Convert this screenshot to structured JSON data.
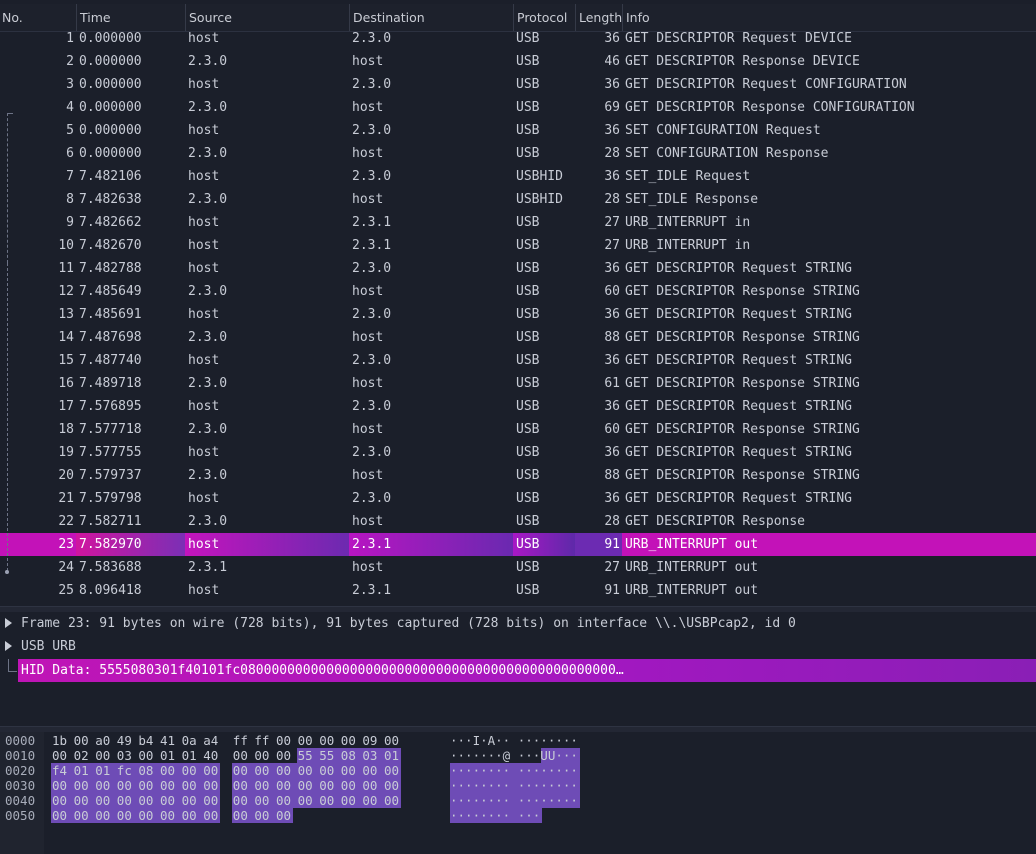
{
  "columns": {
    "no": "No.",
    "time": "Time",
    "source": "Source",
    "destination": "Destination",
    "protocol": "Protocol",
    "length": "Length",
    "info": "Info"
  },
  "packets": [
    {
      "no": "1",
      "time": "0.000000",
      "src": "host",
      "dst": "2.3.0",
      "proto": "USB",
      "len": "36",
      "info": "GET DESCRIPTOR Request DEVICE"
    },
    {
      "no": "2",
      "time": "0.000000",
      "src": "2.3.0",
      "dst": "host",
      "proto": "USB",
      "len": "46",
      "info": "GET DESCRIPTOR Response DEVICE"
    },
    {
      "no": "3",
      "time": "0.000000",
      "src": "host",
      "dst": "2.3.0",
      "proto": "USB",
      "len": "36",
      "info": "GET DESCRIPTOR Request CONFIGURATION"
    },
    {
      "no": "4",
      "time": "0.000000",
      "src": "2.3.0",
      "dst": "host",
      "proto": "USB",
      "len": "69",
      "info": "GET DESCRIPTOR Response CONFIGURATION"
    },
    {
      "no": "5",
      "time": "0.000000",
      "src": "host",
      "dst": "2.3.0",
      "proto": "USB",
      "len": "36",
      "info": "SET CONFIGURATION Request"
    },
    {
      "no": "6",
      "time": "0.000000",
      "src": "2.3.0",
      "dst": "host",
      "proto": "USB",
      "len": "28",
      "info": "SET CONFIGURATION Response"
    },
    {
      "no": "7",
      "time": "7.482106",
      "src": "host",
      "dst": "2.3.0",
      "proto": "USBHID",
      "len": "36",
      "info": "SET_IDLE Request"
    },
    {
      "no": "8",
      "time": "7.482638",
      "src": "2.3.0",
      "dst": "host",
      "proto": "USBHID",
      "len": "28",
      "info": "SET_IDLE Response"
    },
    {
      "no": "9",
      "time": "7.482662",
      "src": "host",
      "dst": "2.3.1",
      "proto": "USB",
      "len": "27",
      "info": "URB_INTERRUPT in"
    },
    {
      "no": "10",
      "time": "7.482670",
      "src": "host",
      "dst": "2.3.1",
      "proto": "USB",
      "len": "27",
      "info": "URB_INTERRUPT in"
    },
    {
      "no": "11",
      "time": "7.482788",
      "src": "host",
      "dst": "2.3.0",
      "proto": "USB",
      "len": "36",
      "info": "GET DESCRIPTOR Request STRING"
    },
    {
      "no": "12",
      "time": "7.485649",
      "src": "2.3.0",
      "dst": "host",
      "proto": "USB",
      "len": "60",
      "info": "GET DESCRIPTOR Response STRING"
    },
    {
      "no": "13",
      "time": "7.485691",
      "src": "host",
      "dst": "2.3.0",
      "proto": "USB",
      "len": "36",
      "info": "GET DESCRIPTOR Request STRING"
    },
    {
      "no": "14",
      "time": "7.487698",
      "src": "2.3.0",
      "dst": "host",
      "proto": "USB",
      "len": "88",
      "info": "GET DESCRIPTOR Response STRING"
    },
    {
      "no": "15",
      "time": "7.487740",
      "src": "host",
      "dst": "2.3.0",
      "proto": "USB",
      "len": "36",
      "info": "GET DESCRIPTOR Request STRING"
    },
    {
      "no": "16",
      "time": "7.489718",
      "src": "2.3.0",
      "dst": "host",
      "proto": "USB",
      "len": "61",
      "info": "GET DESCRIPTOR Response STRING"
    },
    {
      "no": "17",
      "time": "7.576895",
      "src": "host",
      "dst": "2.3.0",
      "proto": "USB",
      "len": "36",
      "info": "GET DESCRIPTOR Request STRING"
    },
    {
      "no": "18",
      "time": "7.577718",
      "src": "2.3.0",
      "dst": "host",
      "proto": "USB",
      "len": "60",
      "info": "GET DESCRIPTOR Response STRING"
    },
    {
      "no": "19",
      "time": "7.577755",
      "src": "host",
      "dst": "2.3.0",
      "proto": "USB",
      "len": "36",
      "info": "GET DESCRIPTOR Request STRING"
    },
    {
      "no": "20",
      "time": "7.579737",
      "src": "2.3.0",
      "dst": "host",
      "proto": "USB",
      "len": "88",
      "info": "GET DESCRIPTOR Response STRING"
    },
    {
      "no": "21",
      "time": "7.579798",
      "src": "host",
      "dst": "2.3.0",
      "proto": "USB",
      "len": "36",
      "info": "GET DESCRIPTOR Request STRING"
    },
    {
      "no": "22",
      "time": "7.582711",
      "src": "2.3.0",
      "dst": "host",
      "proto": "USB",
      "len": "28",
      "info": "GET DESCRIPTOR Response"
    },
    {
      "no": "23",
      "time": "7.582970",
      "src": "host",
      "dst": "2.3.1",
      "proto": "USB",
      "len": "91",
      "info": "URB_INTERRUPT out",
      "selected": true
    },
    {
      "no": "24",
      "time": "7.583688",
      "src": "2.3.1",
      "dst": "host",
      "proto": "USB",
      "len": "27",
      "info": "URB_INTERRUPT out"
    },
    {
      "no": "25",
      "time": "8.096418",
      "src": "host",
      "dst": "2.3.1",
      "proto": "USB",
      "len": "91",
      "info": "URB_INTERRUPT out"
    }
  ],
  "details": {
    "frame": "Frame 23: 91 bytes on wire (728 bits), 91 bytes captured (728 bits) on interface \\\\.\\USBPcap2, id 0",
    "usb_urb": "USB URB",
    "hid_data": "HID Data: 5555080301f40101fc080000000000000000000000000000000000000000000000…"
  },
  "hex": [
    {
      "off": "0000",
      "bytes": [
        "1b",
        "00",
        "a0",
        "49",
        "b4",
        "41",
        "0a",
        "a4",
        "ff",
        "ff",
        "00",
        "00",
        "00",
        "00",
        "09",
        "00"
      ],
      "ascii": "···I·A·· ········"
    },
    {
      "off": "0010",
      "bytes": [
        "00",
        "02",
        "00",
        "03",
        "00",
        "01",
        "01",
        "40",
        "00",
        "00",
        "00",
        "55",
        "55",
        "08",
        "03",
        "01"
      ],
      "ascii": "·······@ ···UU···"
    },
    {
      "off": "0020",
      "bytes": [
        "f4",
        "01",
        "01",
        "fc",
        "08",
        "00",
        "00",
        "00",
        "00",
        "00",
        "00",
        "00",
        "00",
        "00",
        "00",
        "00"
      ],
      "ascii": "········ ········"
    },
    {
      "off": "0030",
      "bytes": [
        "00",
        "00",
        "00",
        "00",
        "00",
        "00",
        "00",
        "00",
        "00",
        "00",
        "00",
        "00",
        "00",
        "00",
        "00",
        "00"
      ],
      "ascii": "········ ········"
    },
    {
      "off": "0040",
      "bytes": [
        "00",
        "00",
        "00",
        "00",
        "00",
        "00",
        "00",
        "00",
        "00",
        "00",
        "00",
        "00",
        "00",
        "00",
        "00",
        "00"
      ],
      "ascii": "········ ········"
    },
    {
      "off": "0050",
      "bytes": [
        "00",
        "00",
        "00",
        "00",
        "00",
        "00",
        "00",
        "00",
        "00",
        "00",
        "00"
      ],
      "ascii": "········ ···"
    }
  ],
  "colors": {
    "selected": "#c312b8",
    "highlight": "#6e4cb6",
    "background": "#1b1f2a"
  }
}
